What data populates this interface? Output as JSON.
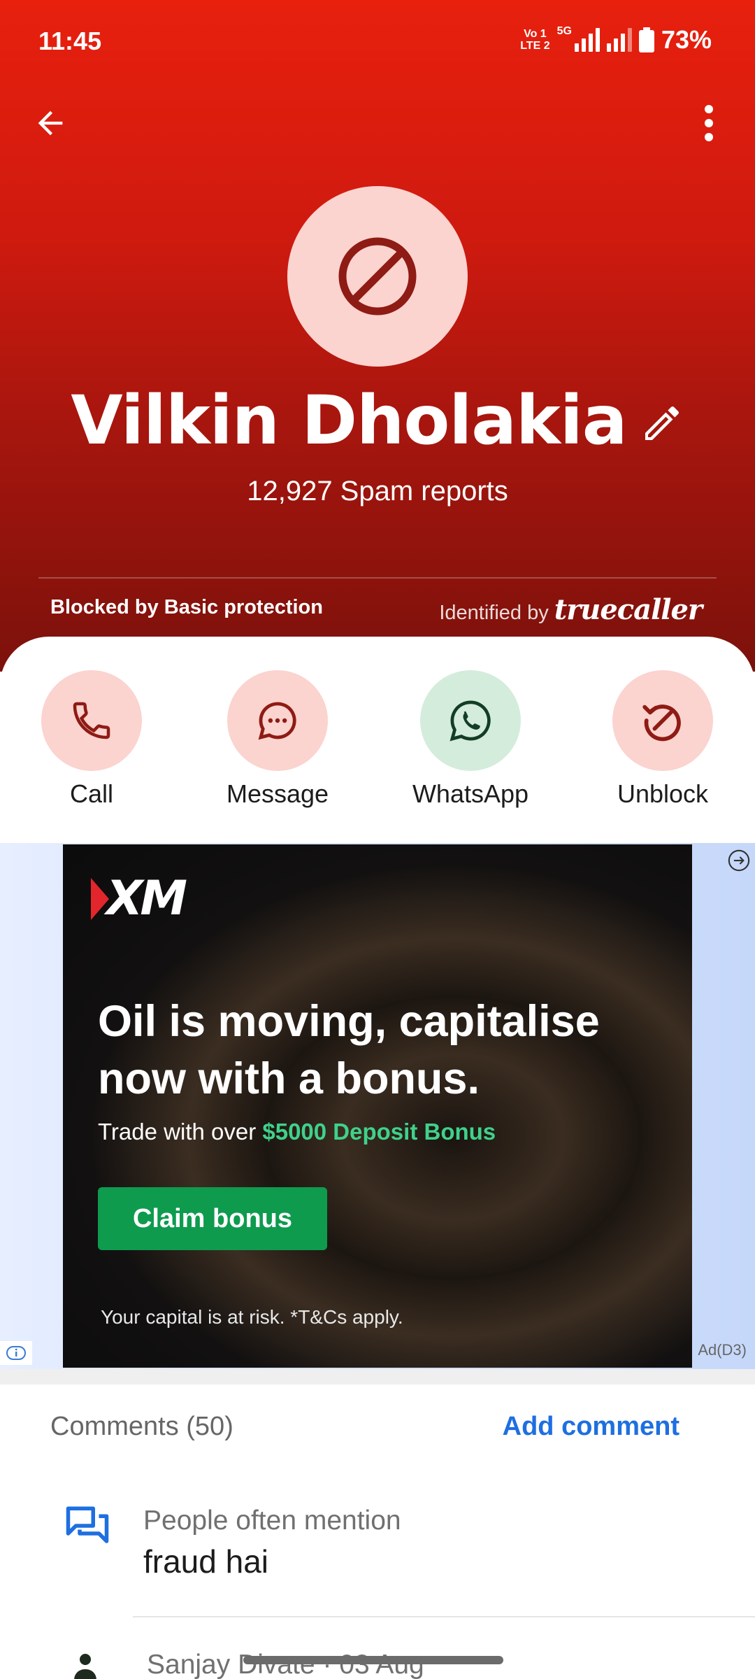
{
  "status_bar": {
    "time": "11:45",
    "network_badge_top": "Vo 1",
    "network_badge_bottom": "LTE 2",
    "network_type": "5G",
    "battery": "73%"
  },
  "contact": {
    "name": "Vilkin Dholakia",
    "spam_reports": "12,927 Spam reports",
    "blocked_by": "Blocked by Basic protection",
    "identified_prefix": "Identified by",
    "identified_brand": "truecaller"
  },
  "actions": [
    {
      "label": "Call",
      "icon": "phone-icon"
    },
    {
      "label": "Message",
      "icon": "chat-bubble-icon"
    },
    {
      "label": "WhatsApp",
      "icon": "whatsapp-icon"
    },
    {
      "label": "Unblock",
      "icon": "unblock-icon"
    }
  ],
  "ad": {
    "brand": "XM",
    "headline": "Oil is moving, capitalise now with a bonus.",
    "subtext_prefix": "Trade with over",
    "subtext_highlight": "$5000 Deposit Bonus",
    "cta": "Claim bonus",
    "disclaimer": "Your capital is at risk. *T&Cs apply.",
    "label": "Ad(D3)"
  },
  "comments": {
    "title": "Comments (50)",
    "add_label": "Add comment",
    "mention_label": "People often mention",
    "mention_value": "fraud hai",
    "first_comment_meta": "Sanjay Divate · 03 Aug"
  },
  "colors": {
    "header_top": "#e8200e",
    "header_bottom": "#7c110b",
    "avatar_bg": "#fbd3cf",
    "block_icon": "#8e1b14",
    "accent_blue": "#1e6fe0",
    "whatsapp_bg": "#d4ecdc",
    "cta_green": "#0e9b4e"
  }
}
